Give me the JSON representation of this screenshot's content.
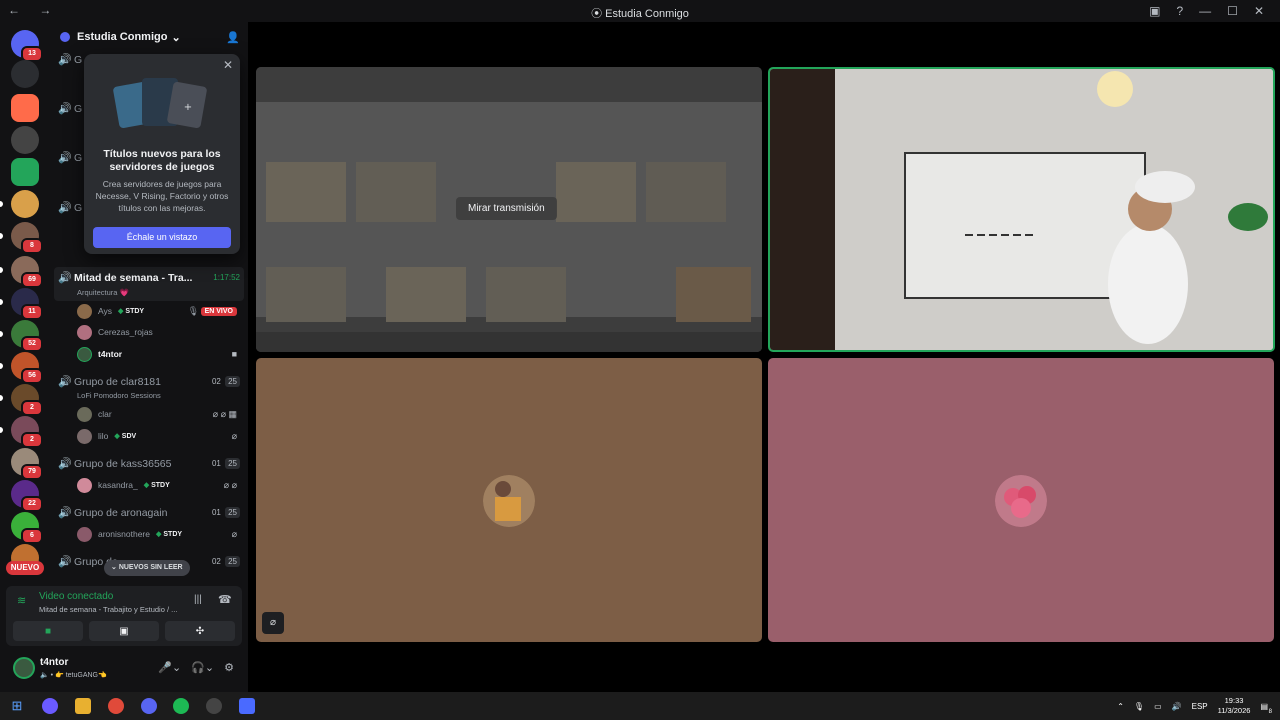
{
  "window": {
    "title": "Estudia Conmigo"
  },
  "servers": [
    {
      "name": "discord-home",
      "badge": "13",
      "color": "#5865f2"
    },
    {
      "name": "hourglass",
      "badge": "",
      "color": "#2b2d31"
    },
    {
      "name": "gradient",
      "badge": "",
      "color": "#ff6b4a"
    },
    {
      "name": "cat",
      "badge": "",
      "color": "#444"
    },
    {
      "name": "bolt",
      "badge": "",
      "color": "#23a55a"
    },
    {
      "name": "rainbow",
      "badge": "",
      "color": "#d9a04a"
    },
    {
      "name": "group",
      "badge": "8",
      "color": "#7a5a4a"
    },
    {
      "name": "face",
      "badge": "69",
      "color": "#8a6a5a"
    },
    {
      "name": "dark",
      "badge": "11",
      "color": "#2a2a4a"
    },
    {
      "name": "green",
      "badge": "52",
      "color": "#3a7a3a"
    },
    {
      "name": "fire",
      "badge": "56",
      "color": "#c0542a"
    },
    {
      "name": "game",
      "badge": "2",
      "color": "#6a4a2a"
    },
    {
      "name": "people",
      "badge": "2",
      "color": "#7a4a5a"
    },
    {
      "name": "anime",
      "badge": "79",
      "color": "#9a8a7a"
    },
    {
      "name": "purple",
      "badge": "22",
      "color": "#5a2a8a"
    },
    {
      "name": "frog",
      "badge": "6",
      "color": "#3ab03a"
    },
    {
      "name": "tiger",
      "badge": "",
      "color": "#c07030"
    }
  ],
  "nuevo_label": "NUEVO",
  "server_name": "Estudia Conmigo",
  "popup": {
    "title": "Títulos nuevos para los servidores de juegos",
    "description": "Crea servidores de juegos para Necesse, V Rising, Factorio y otros títulos con las mejoras.",
    "button": "Échale un vistazo"
  },
  "channels": {
    "hidden": [
      "G",
      "G",
      "G",
      "G"
    ],
    "mitad": {
      "name": "Mitad de semana - Tra...",
      "time": "1:17:52",
      "status": "Arquitectura 💗",
      "users": [
        {
          "name": "Ays",
          "tag": "STDY",
          "live": "EN VIVO",
          "color": "#8a6a4a"
        },
        {
          "name": "Cerezas_rojas",
          "tag": "",
          "live": "",
          "color": "#b07080"
        },
        {
          "name": "t4ntor",
          "tag": "",
          "live": "",
          "color": "#3a5a40"
        }
      ]
    },
    "clar": {
      "name": "Grupo de clar8181",
      "count": "02",
      "cap": "25",
      "status": "LoFi Pomodoro Sessions",
      "users": [
        {
          "name": "clar",
          "tag": "",
          "color": "#6a6a5a"
        },
        {
          "name": "lilo",
          "tag": "SDV",
          "color": "#7a6a6a"
        }
      ]
    },
    "kass": {
      "name": "Grupo de kass36565",
      "count": "01",
      "cap": "25",
      "users": [
        {
          "name": "kasandra_",
          "tag": "STDY",
          "color": "#d08a9a"
        }
      ]
    },
    "aron": {
      "name": "Grupo de aronagain",
      "count": "01",
      "cap": "25",
      "users": [
        {
          "name": "aronisnothere",
          "tag": "STDY",
          "color": "#8a5a6a"
        }
      ]
    },
    "last": {
      "name": "Grupo de ...",
      "count": "02",
      "cap": "25"
    }
  },
  "unread_label": "NUEVOS SIN LEER",
  "voice": {
    "status": "Video conectado",
    "channel": "Mitad de semana - Trabajito y Estudio / ..."
  },
  "me": {
    "name": "t4ntor",
    "status": "🔈 • 👉 tetuGANG👈"
  },
  "stage": {
    "watch_label": "Mirar transmisión"
  },
  "taskbar": {
    "lang": "ESP",
    "time": "19:33",
    "date": "11/3/2026",
    "notifications": "8"
  }
}
